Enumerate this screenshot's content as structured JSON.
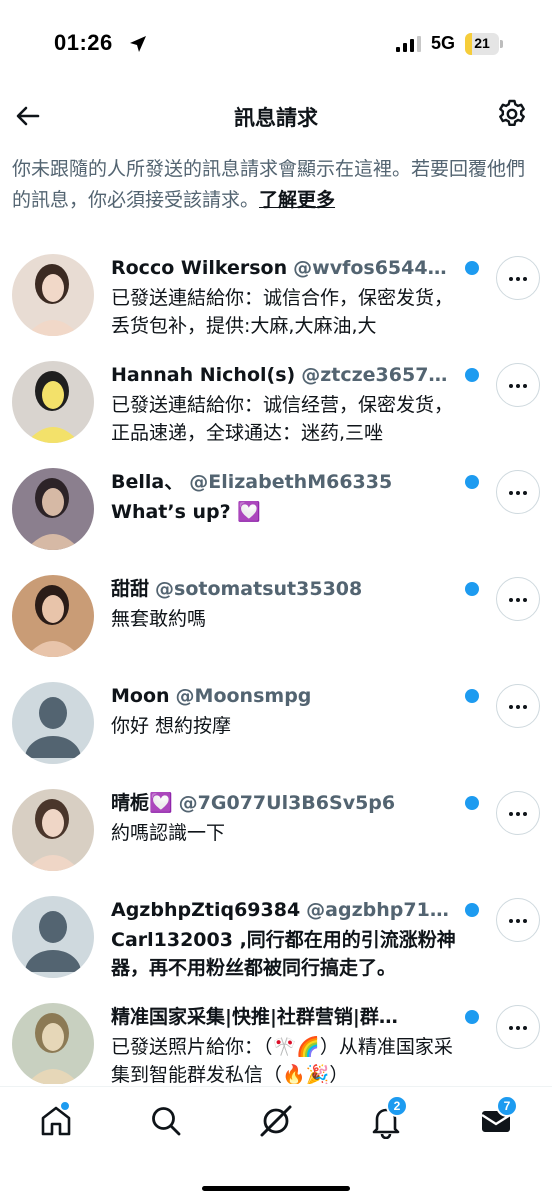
{
  "status_bar": {
    "time": "01:26",
    "network": "5G",
    "battery": "21",
    "battery_fraction": 0.21
  },
  "header": {
    "title": "訊息請求"
  },
  "info": {
    "text": "你未跟隨的人所發送的訊息請求會顯示在這裡。若要回覆他們的訊息，你必須接受該請求。",
    "link": "了解更多"
  },
  "requests": [
    {
      "name": "Rocco Wilkerson",
      "handle": "@wvfos6544…",
      "preview": "已發送連結給你：诚信合作，保密发货，丢货包补，提供:大麻,大麻油,大",
      "unread": true,
      "avatar": "photo"
    },
    {
      "name": "Hannah Nichol(s)",
      "handle": "@ztcze3657…",
      "preview": "已發送連結給你：诚信经营，保密发货，正品速递，全球通达：迷药,三唑",
      "unread": true,
      "avatar": "photo"
    },
    {
      "name": "Bella、",
      "handle": "@ElizabethM66335",
      "preview": "What’s up? 💟",
      "unread": true,
      "avatar": "photo"
    },
    {
      "name": "甜甜",
      "handle": "@sotomatsut35308",
      "preview": "無套敢約嗎",
      "unread": true,
      "avatar": "photo"
    },
    {
      "name": "Moon",
      "handle": "@Moonsmpg",
      "preview": "你好 想約按摩",
      "unread": true,
      "avatar": "default"
    },
    {
      "name": "晴栀💟",
      "handle": "@7G077Ul3B6Sv5p6",
      "preview": "約嗎認識一下",
      "unread": true,
      "avatar": "photo"
    },
    {
      "name": "AgzbhpZtiq69384",
      "handle": "@agzbhp71…",
      "preview": "Carl132003 ,同行都在用的引流涨粉神器，再不用粉丝都被同行搞走了。",
      "unread": true,
      "avatar": "default"
    },
    {
      "name": "精准国家采集|快推|社群营销|群…",
      "handle": "",
      "preview": "已發送照片給你：（🎌🌈）从精准国家采集到智能群发私信（🔥🎉）",
      "unread": true,
      "avatar": "photo"
    }
  ],
  "tab_bar": {
    "home_icon": "home-icon",
    "search_icon": "search-icon",
    "grok_icon": "grok-icon",
    "notifications_badge": "2",
    "messages_badge": "7"
  },
  "colors": {
    "accent": "#1d9bf0",
    "text": "#0f1419",
    "muted": "#536471",
    "battery": "#f6cd3a"
  }
}
